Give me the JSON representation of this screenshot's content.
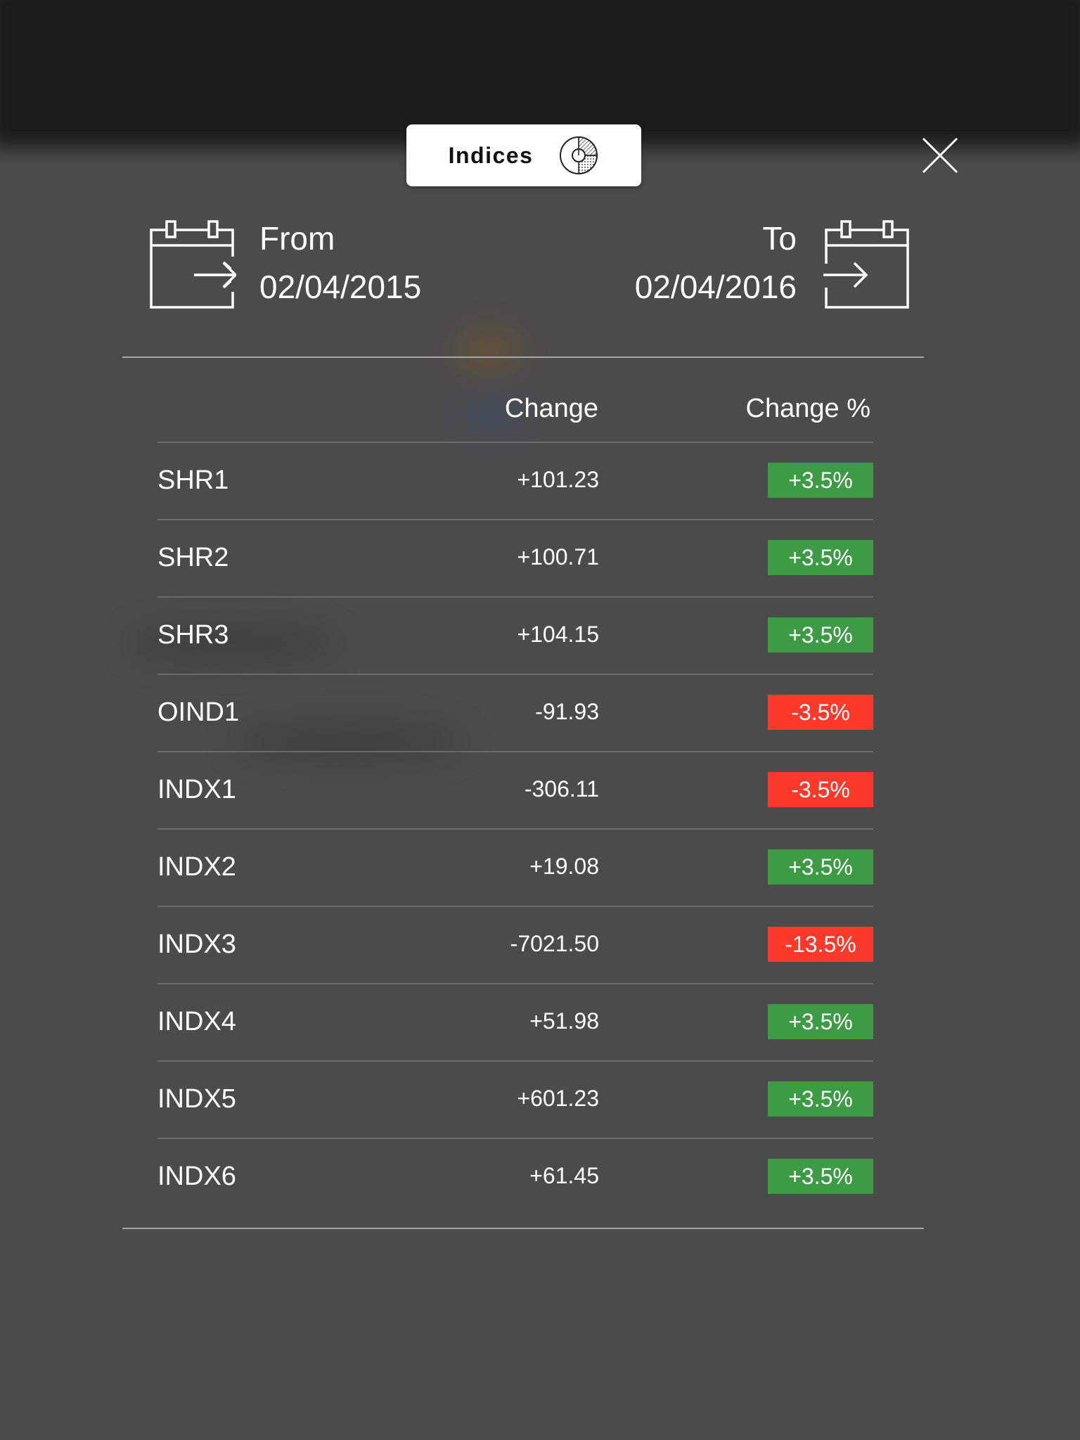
{
  "header": {
    "title": "Indices",
    "title_icon": "pie-chart-icon",
    "close_icon": "close-icon"
  },
  "dates": {
    "from_label": "From",
    "from_value": "02/04/2015",
    "to_label": "To",
    "to_value": "02/04/2016"
  },
  "table": {
    "columns": [
      "",
      "Change",
      "Change %"
    ],
    "rows": [
      {
        "name": "SHR1",
        "change": "+101.23",
        "pct": "+3.5%",
        "direction": "up"
      },
      {
        "name": "SHR2",
        "change": "+100.71",
        "pct": "+3.5%",
        "direction": "up"
      },
      {
        "name": "SHR3",
        "change": "+104.15",
        "pct": "+3.5%",
        "direction": "up"
      },
      {
        "name": "OIND1",
        "change": "-91.93",
        "pct": "-3.5%",
        "direction": "down"
      },
      {
        "name": "INDX1",
        "change": "-306.11",
        "pct": "-3.5%",
        "direction": "down"
      },
      {
        "name": "INDX2",
        "change": "+19.08",
        "pct": "+3.5%",
        "direction": "up"
      },
      {
        "name": "INDX3",
        "change": "-7021.50",
        "pct": "-13.5%",
        "direction": "down"
      },
      {
        "name": "INDX4",
        "change": "+51.98",
        "pct": "+3.5%",
        "direction": "up"
      },
      {
        "name": "INDX5",
        "change": "+601.23",
        "pct": "+3.5%",
        "direction": "up"
      },
      {
        "name": "INDX6",
        "change": "+61.45",
        "pct": "+3.5%",
        "direction": "up"
      }
    ]
  },
  "colors": {
    "positive": "#3d9b45",
    "negative": "#fc3a2c",
    "overlay": "#4b4b4b"
  }
}
